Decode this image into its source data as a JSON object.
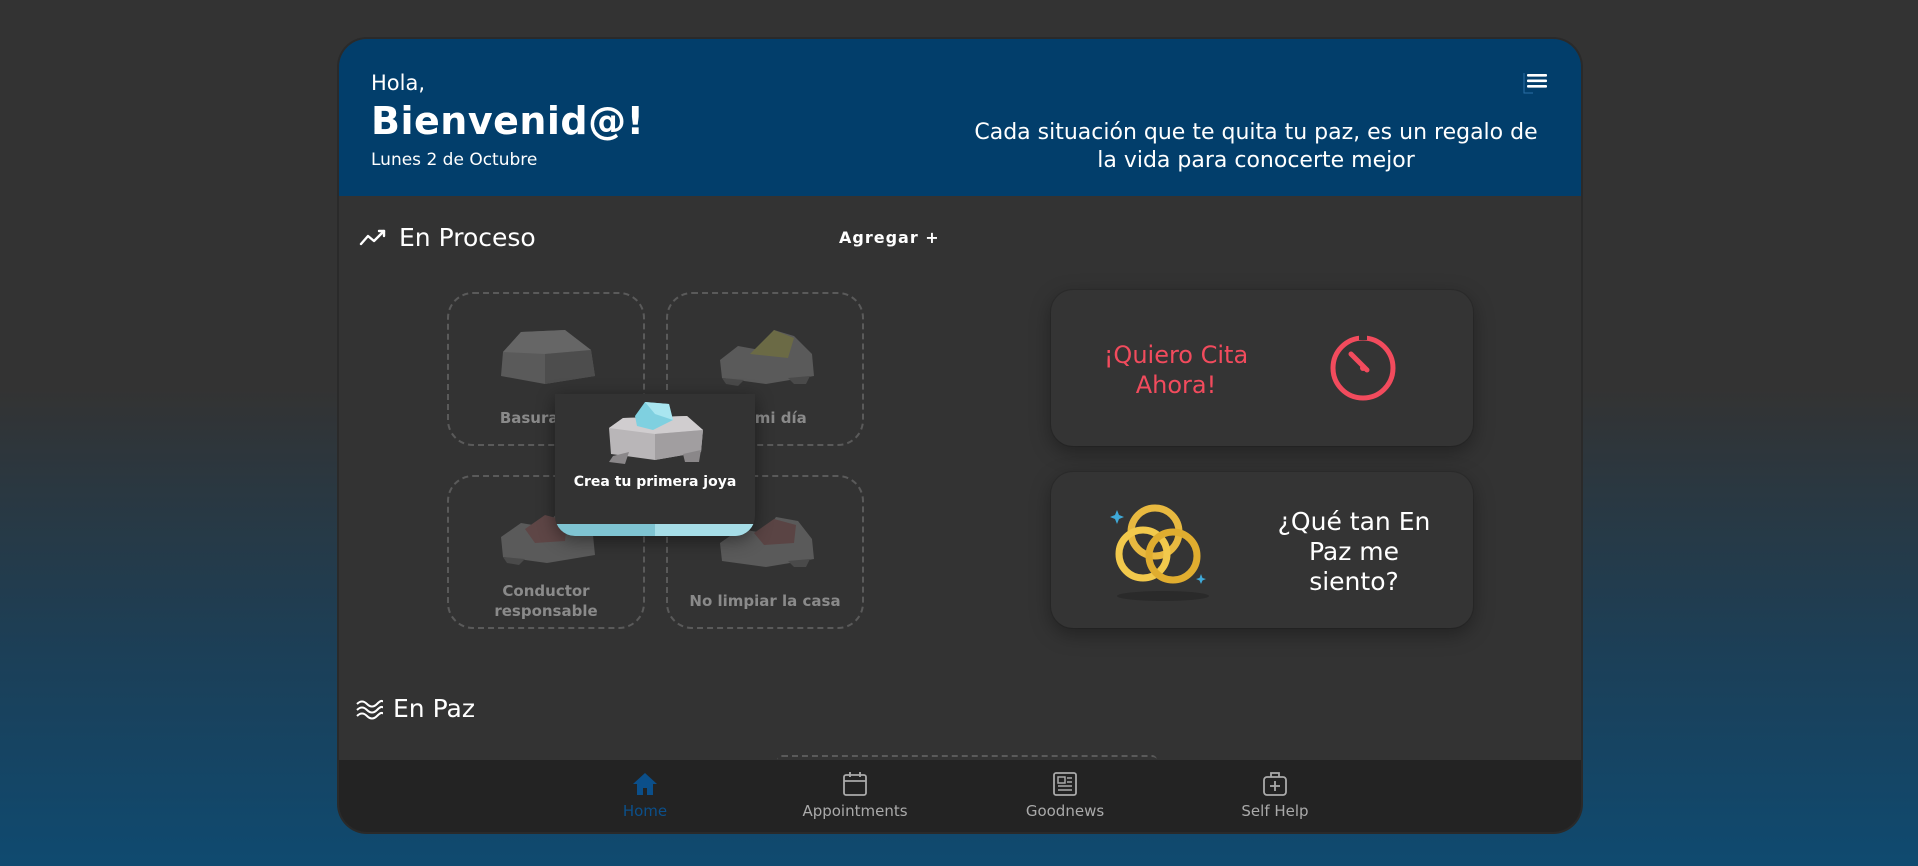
{
  "header": {
    "greeting": "Hola,",
    "welcome": "Bienvenid@!",
    "date": "Lunes 2 de Octubre",
    "quote": "Cada situación que te quita tu paz, es un regalo de la vida para conocerte mejor"
  },
  "in_process": {
    "title": "En Proceso",
    "add_label": "Agregar +",
    "items": [
      {
        "label": "Basura por",
        "rock_color": "#5a5a5a"
      },
      {
        "label": "zar mi día",
        "rock_color": "#6b6a45"
      },
      {
        "label": "Conductor responsable",
        "rock_color": "#5e4646"
      },
      {
        "label": "No limpiar la casa",
        "rock_color": "#5a4444"
      }
    ],
    "popup": {
      "text": "Crea tu primera joya"
    }
  },
  "actions": {
    "cita": {
      "label": "¡Quiero Cita Ahora!",
      "color": "#f24b5d"
    },
    "paz": {
      "label": "¿Qué tan En Paz me siento?"
    }
  },
  "at_peace": {
    "title": "En Paz"
  },
  "nav": {
    "items": [
      {
        "label": "Home",
        "icon": "home-icon",
        "active": true
      },
      {
        "label": "Appointments",
        "icon": "calendar-icon"
      },
      {
        "label": "Goodnews",
        "icon": "newspaper-icon"
      },
      {
        "label": "Self Help",
        "icon": "first-aid-kit-icon"
      }
    ]
  },
  "colors": {
    "header": "#023e6b",
    "accent": "#f24b5d",
    "active_nav": "#0b4f8a"
  }
}
